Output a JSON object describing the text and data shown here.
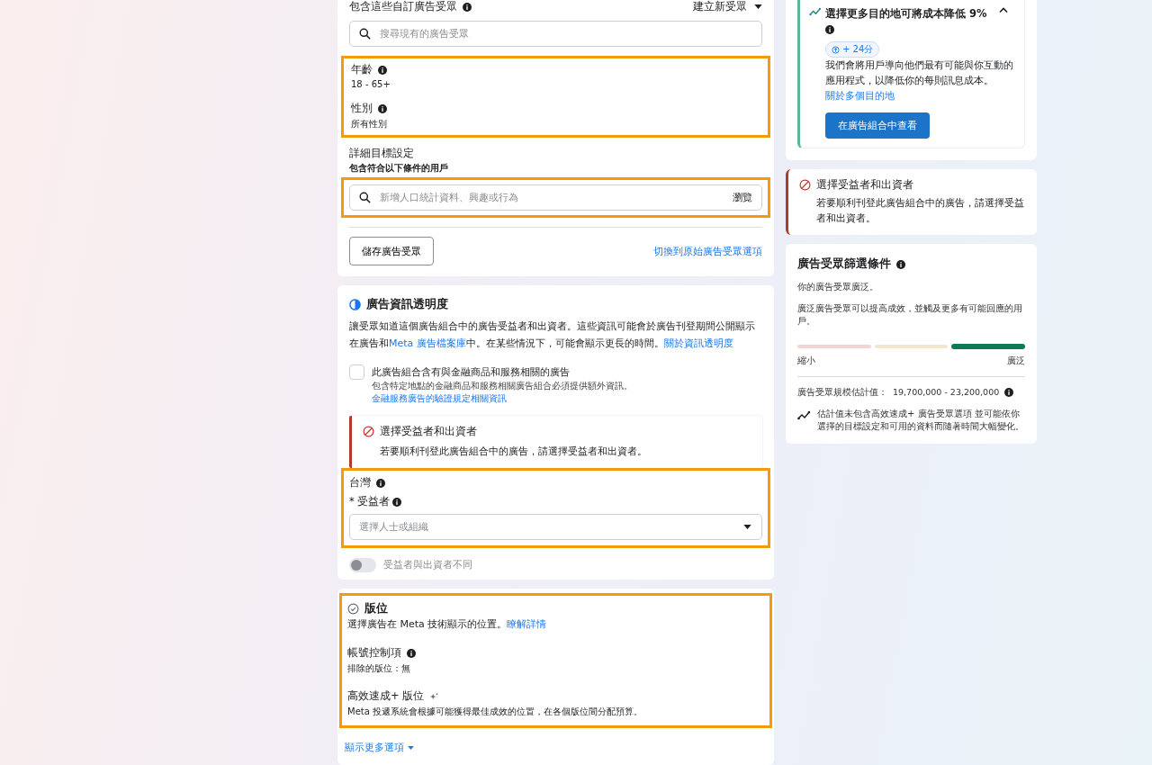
{
  "audience_card": {
    "custom_audience_label": "包含這些自訂廣告受眾",
    "create_menu": "建立新受眾",
    "custom_search": {
      "placeholder": "搜尋現有的廣告受眾"
    },
    "demographics": {
      "highlighted": true,
      "fields": [
        {
          "label": "年齡",
          "value": "18 - 65+"
        },
        {
          "label": "性別",
          "value": "所有性別"
        }
      ]
    },
    "detailed_targeting": {
      "title": "詳細目標設定",
      "subtitle": "包含符合以下條件的用戶"
    },
    "targeting_search": {
      "highlighted": true,
      "placeholder": "新增人口統計資料、興趣或行為",
      "browse": "瀏覽"
    },
    "save_button": "儲存廣告受眾",
    "switch_link": "切換到原始廣告受眾選項"
  },
  "transparency_card": {
    "title": "廣告資訊透明度",
    "description": [
      {
        "text": "讓受眾知道這個廣告組合中的廣告受益者和出資者。這些資訊可能會於廣告刊登期間公開顯示在廣告和",
        "link": false
      },
      {
        "text": "Meta 廣告檔案庫",
        "link": true
      },
      {
        "text": "中。在某些情況下，可能會顯示更長的時間。",
        "link": false
      },
      {
        "text": "關於資訊透明度",
        "link": true
      }
    ],
    "financial_checkbox": {
      "checked": false,
      "label": "此廣告組合含有與金融商品和服務相關的廣告",
      "note": "包含特定地點的金融商品和服務相關廣告組合必須提供額外資訊。",
      "note_link": "金融服務廣告的驗證規定相關資訊"
    },
    "alert": {
      "title": "選擇受益者和出資者",
      "message": "若要順利刊登此廣告組合中的廣告，請選擇受益者和出資者。"
    },
    "region": {
      "highlighted": true,
      "country": "台灣",
      "required_mark": "*",
      "beneficiary_label": "受益者",
      "beneficiary_select": {
        "placeholder": "選擇人士或組織"
      }
    },
    "different_payer_toggle": {
      "on": false,
      "label": "受益者與出資者不同"
    }
  },
  "placements_card": {
    "highlighted": true,
    "title": "版位",
    "description": "選擇廣告在 Meta 技術顯示的位置。",
    "learn_more": "瞭解詳情",
    "sections": [
      {
        "title": "帳號控制項",
        "kind": "info",
        "text": "排除的版位：無"
      },
      {
        "title": "高效速成+ 版位",
        "kind": "sparkle",
        "text": "Meta 投遞系統會根據可能獲得最佳成效的位置，在各個版位間分配預算。"
      }
    ],
    "show_more": "顯示更多選項"
  },
  "tip_card": {
    "title": "選擇更多目的地可將成本降低 9%",
    "expanded": true,
    "score": "+ 24分",
    "body": "我們會將用戶導向他們最有可能與你互動的應用程式，以降低你的每則訊息成本。",
    "link": "關於多個目的地",
    "button": "在廣告組合中查看"
  },
  "side_alert": {
    "title": "選擇受益者和出資者",
    "message": "若要順利刊登此廣告組合中的廣告，請選擇受益者和出資者。"
  },
  "audience_definition": {
    "title": "廣告受眾篩選條件",
    "status": "你的廣告受眾廣泛。",
    "explanation": "廣泛廣告受眾可以提高成效，並觸及更多有可能回應的用戶。",
    "segments": [
      {
        "selected": false,
        "color": "#f2d4d4"
      },
      {
        "selected": false,
        "color": "#f4e6c8"
      },
      {
        "selected": true,
        "color": "#0e7a55"
      }
    ],
    "min_label": "縮小",
    "max_label": "廣泛",
    "size_label": "廣告受眾規模估計值：",
    "size_value": "19,700,000 - 23,200,000",
    "footnote": "估計值未包含高效速成+ 廣告受眾選項 並可能依你選擇的目標設定和可用的資料而隨著時間大幅變化。"
  }
}
